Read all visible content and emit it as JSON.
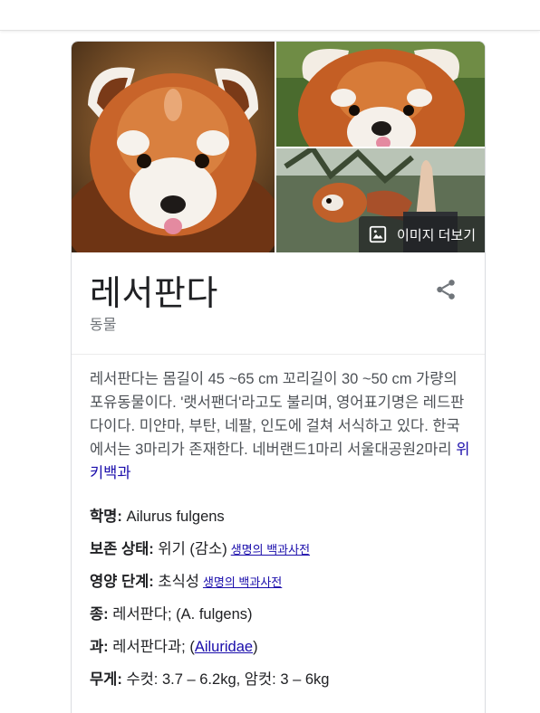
{
  "header": {
    "title": "레서판다",
    "subtitle": "동물"
  },
  "images": {
    "more_label": "이미지 더보기",
    "alts": [
      "레서판다 얼굴",
      "혀를 내민 레서판다",
      "사람 손과 레서판다"
    ]
  },
  "description": {
    "text": "레서판다는 몸길이 45 ~65 cm 꼬리길이 30 ~50 cm 가량의 포유동물이다. '랫서팬더'라고도 불리며, 영어표기명은 레드판다이다. 미얀마, 부탄, 네팔, 인도에 걸쳐 서식하고 있다. 한국에서는 3마리가 존재한다. 네버랜드1마리 서울대공원2마리 ",
    "source": "위키백과"
  },
  "facts": [
    {
      "label": "학명:",
      "value": " Ailurus fulgens",
      "source": ""
    },
    {
      "label": "보존 상태:",
      "value": " 위기 (감소)",
      "source": "생명의 백과사전"
    },
    {
      "label": "영양 단계:",
      "value": " 초식성",
      "source": "생명의 백과사전"
    },
    {
      "label": "종:",
      "value": " 레서판다; (A. fulgens)",
      "source": ""
    },
    {
      "label": "과:",
      "value": " 레서판다과; (",
      "link": "Ailuridae",
      "after": ")"
    },
    {
      "label": "무게:",
      "value": " 수컷: 3.7 – 6.2kg, 암컷: 3 – 6kg",
      "source": ""
    }
  ],
  "colors": {
    "link": "#1a0dab",
    "fur": "#c8642a",
    "text_secondary": "#70757a"
  }
}
